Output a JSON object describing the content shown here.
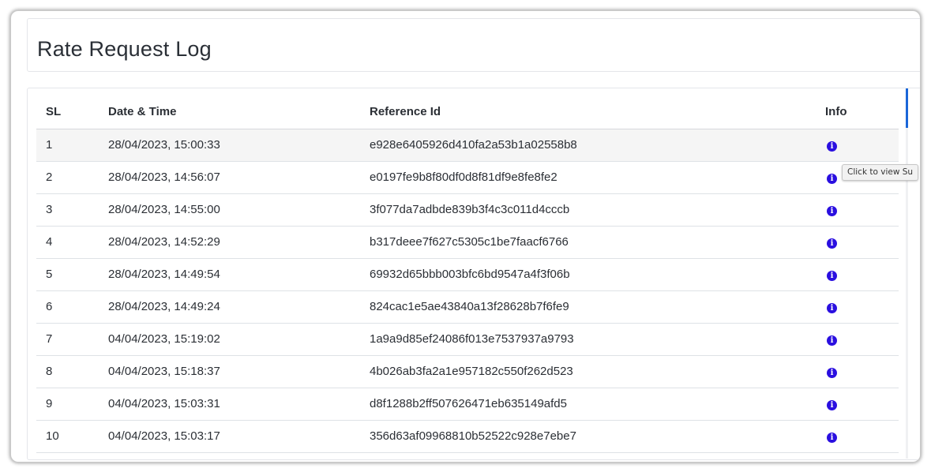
{
  "page": {
    "title": "Rate Request Log"
  },
  "table": {
    "columns": {
      "sl": "SL",
      "datetime": "Date & Time",
      "reference": "Reference Id",
      "info": "Info"
    },
    "rows": [
      {
        "sl": "1",
        "datetime": "28/04/2023, 15:00:33",
        "reference": "e928e6405926d410fa2a53b1a02558b8"
      },
      {
        "sl": "2",
        "datetime": "28/04/2023, 14:56:07",
        "reference": "e0197fe9b8f80df0d8f81df9e8fe8fe2"
      },
      {
        "sl": "3",
        "datetime": "28/04/2023, 14:55:00",
        "reference": "3f077da7adbde839b3f4c3c011d4cccb"
      },
      {
        "sl": "4",
        "datetime": "28/04/2023, 14:52:29",
        "reference": "b317deee7f627c5305c1be7faacf6766"
      },
      {
        "sl": "5",
        "datetime": "28/04/2023, 14:49:54",
        "reference": "69932d65bbb003bfc6bd9547a4f3f06b"
      },
      {
        "sl": "6",
        "datetime": "28/04/2023, 14:49:24",
        "reference": "824cac1e5ae43840a13f28628b7f6fe9"
      },
      {
        "sl": "7",
        "datetime": "04/04/2023, 15:19:02",
        "reference": "1a9a9d85ef24086f013e7537937a9793"
      },
      {
        "sl": "8",
        "datetime": "04/04/2023, 15:18:37",
        "reference": "4b026ab3fa2a1e957182c550f262d523"
      },
      {
        "sl": "9",
        "datetime": "04/04/2023, 15:03:31",
        "reference": "d8f1288b2ff507626471eb635149afd5"
      },
      {
        "sl": "10",
        "datetime": "04/04/2023, 15:03:17",
        "reference": "356d63af09968810b52522c928e7ebe7"
      }
    ],
    "info_icon": "info-circle-icon",
    "info_glyph": "i"
  },
  "tooltip": {
    "text": "Click to view Su"
  },
  "colors": {
    "accent": "#2a0fe0",
    "scroll_thumb": "#1a66d8",
    "highlight_row": "#f5f5f5"
  }
}
